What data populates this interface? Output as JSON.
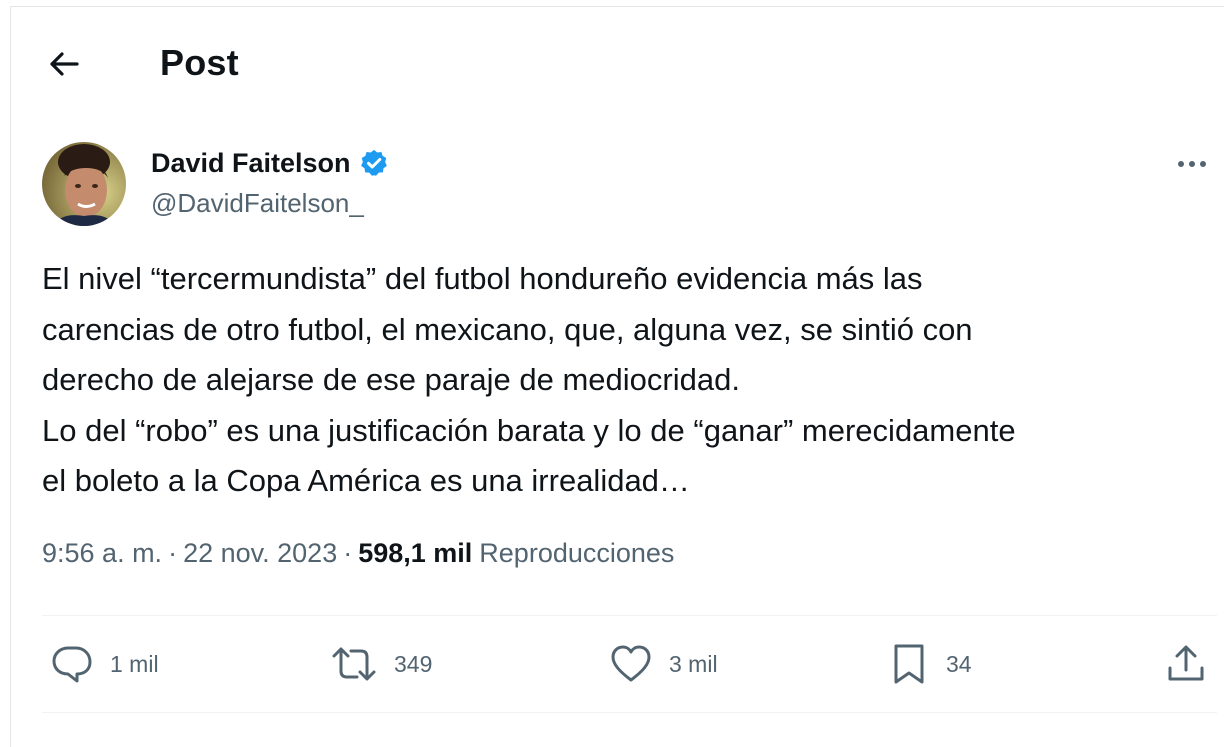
{
  "header": {
    "title": "Post",
    "back_icon": "arrow-left-icon"
  },
  "post": {
    "author": {
      "name": "David Faitelson",
      "handle": "@DavidFaitelson_",
      "verified": true,
      "verified_color": "#1d9bf0"
    },
    "text_lines": [
      "El nivel “tercermundista” del futbol hondureño evidencia más las",
      "carencias de otro futbol, el mexicano, que, alguna vez, se sintió con",
      "derecho de alejarse de ese paraje de mediocridad.",
      "Lo del “robo” es una justificación barata y lo de “ganar” merecidamente",
      "el boleto a la Copa América es una irrealidad…"
    ],
    "time": "9:56 a. m.",
    "separator": "·",
    "date": "22 nov. 2023",
    "views_count": "598,1 mil",
    "views_label": "Reproducciones"
  },
  "actions": {
    "replies": {
      "icon": "reply-icon",
      "count": "1 mil"
    },
    "reposts": {
      "icon": "repost-icon",
      "count": "349"
    },
    "likes": {
      "icon": "heart-icon",
      "count": "3 mil"
    },
    "bookmarks": {
      "icon": "bookmark-icon",
      "count": "34"
    },
    "share": {
      "icon": "share-icon"
    }
  },
  "colors": {
    "text": "#0f1419",
    "secondary": "#536471",
    "divider": "#eff3f4"
  }
}
